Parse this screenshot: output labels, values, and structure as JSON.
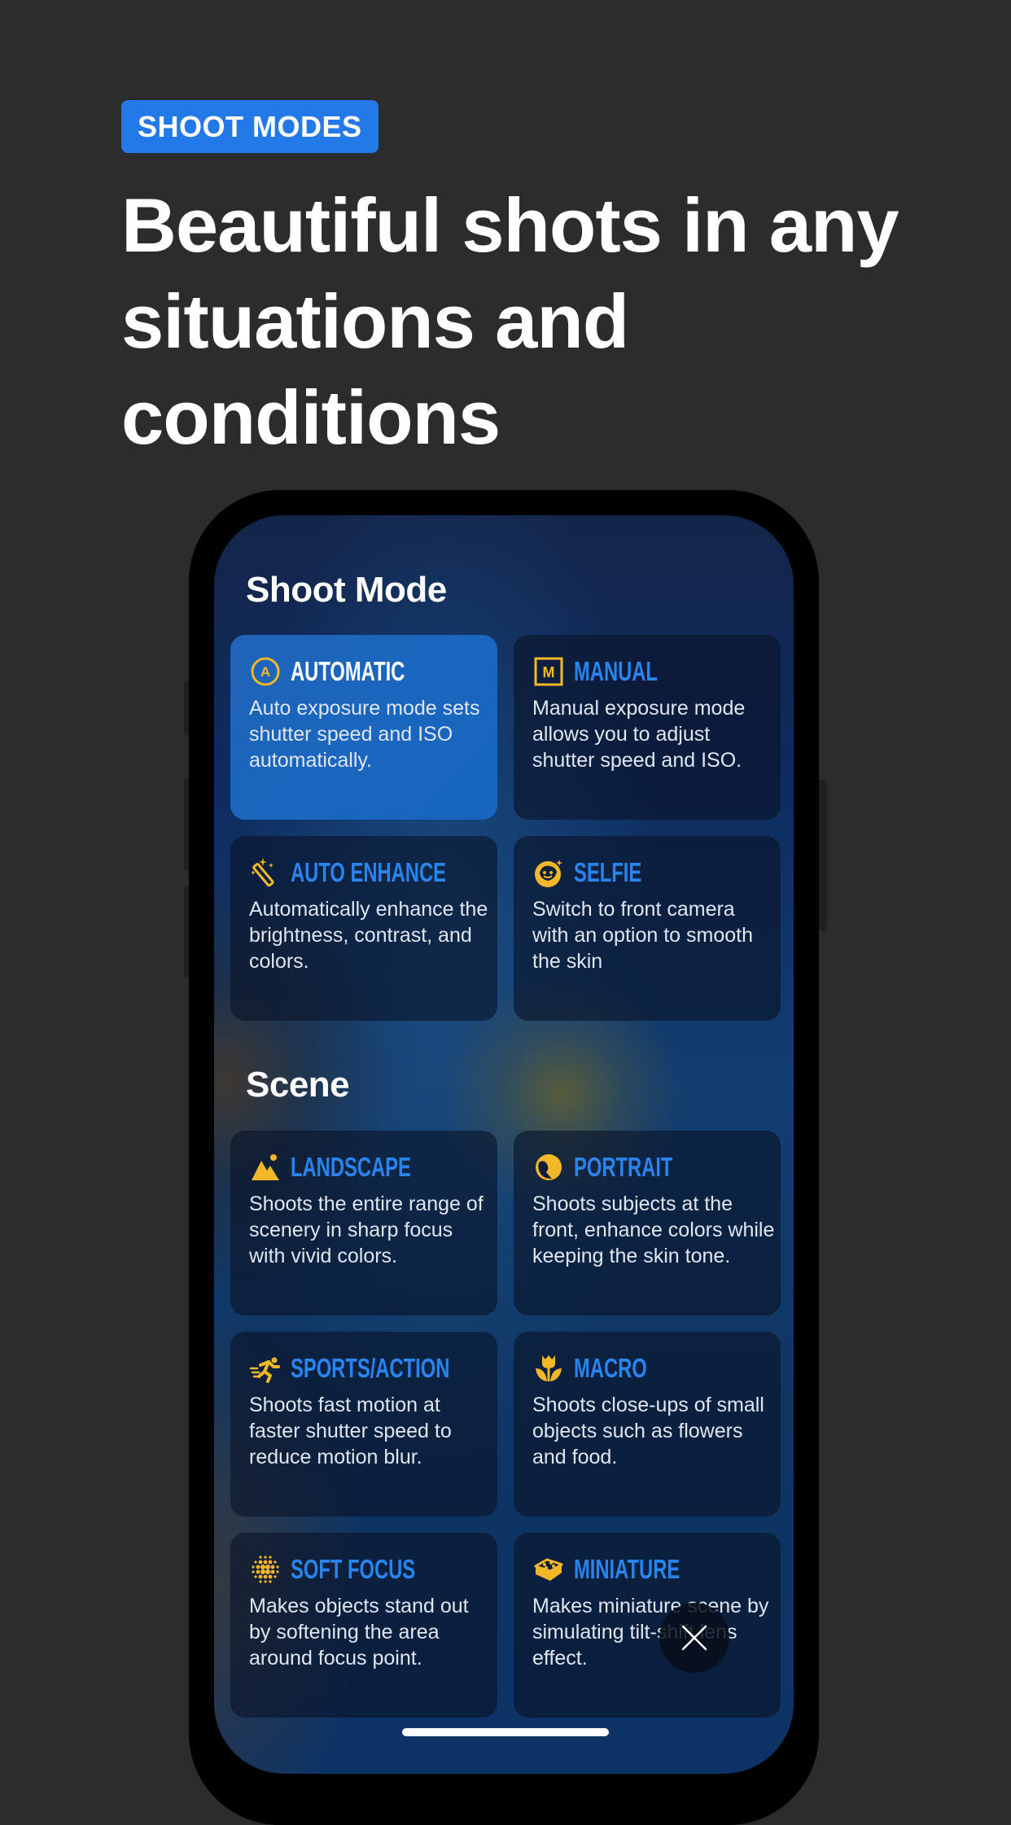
{
  "badge": {
    "label": "SHOOT MODES",
    "color": "#2479e8"
  },
  "headline": {
    "lines": [
      "Beautiful shots in any",
      "situations and",
      "conditions"
    ]
  },
  "app": {
    "sections": [
      {
        "title": "Shoot Mode",
        "cards": [
          {
            "icon": "automatic-a-circle-icon",
            "title": "AUTOMATIC",
            "description": "Auto exposure mode sets shutter speed and ISO automatically.",
            "selected": true
          },
          {
            "icon": "manual-m-square-icon",
            "title": "MANUAL",
            "description": "Manual exposure mode allows you to adjust shutter speed and ISO.",
            "selected": false
          },
          {
            "icon": "magic-wand-icon",
            "title": "AUTO ENHANCE",
            "description": "Automatically enhance the brightness, contrast, and colors.",
            "selected": false
          },
          {
            "icon": "selfie-face-icon",
            "title": "SELFIE",
            "description": "Switch to front camera with an option to smooth the skin",
            "selected": false
          }
        ]
      },
      {
        "title": "Scene",
        "cards": [
          {
            "icon": "landscape-mountain-icon",
            "title": "LANDSCAPE",
            "description": "Shoots the entire range of scenery in sharp focus with vivid colors.",
            "selected": false
          },
          {
            "icon": "portrait-head-icon",
            "title": "PORTRAIT",
            "description": "Shoots subjects at the front, enhance colors while keeping the skin tone.",
            "selected": false
          },
          {
            "icon": "sports-runner-icon",
            "title": "SPORTS/ACTION",
            "description": "Shoots fast motion at faster shutter speed to reduce motion blur.",
            "selected": false
          },
          {
            "icon": "macro-tulip-icon",
            "title": "MACRO",
            "description": "Shoots close-ups of small objects such as flowers and food.",
            "selected": false
          },
          {
            "icon": "soft-focus-dots-icon",
            "title": "SOFT FOCUS",
            "description": "Makes objects stand out by softening the area around focus point.",
            "selected": false
          },
          {
            "icon": "miniature-brick-icon",
            "title": "MINIATURE",
            "description": "Makes miniature scene by simulating tilt-shift lens effect.",
            "selected": false
          }
        ]
      }
    ],
    "close_button": {
      "icon": "close-icon"
    }
  },
  "colors": {
    "background": "#2c2c2c",
    "accent_blue": "#2a84ee",
    "icon_yellow": "#f3b829",
    "selected_card": "#1a66bf"
  }
}
